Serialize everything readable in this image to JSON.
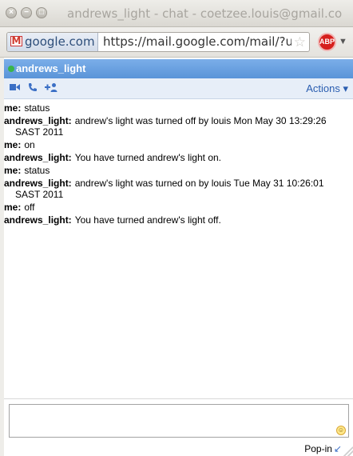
{
  "window": {
    "title": "andrews_light - chat - coetzee.louis@gmail.co",
    "buttons": [
      "×",
      "−",
      "□"
    ]
  },
  "address_bar": {
    "site_label": "google.com",
    "url": "https://mail.google.com/mail/?ui=",
    "star_icon": "star-icon",
    "extension_label": "ABP"
  },
  "chat": {
    "contact_name": "andrews_light",
    "status_color": "#39b54a",
    "toolbar": {
      "icons": [
        "video-icon",
        "phone-icon",
        "add-person-icon"
      ],
      "actions_label": "Actions ▾"
    },
    "messages": [
      {
        "sender": "me:",
        "text": "status"
      },
      {
        "sender": "andrews_light:",
        "text": "andrew's light was turned off by louis Mon May 30 13:29:26 SAST 2011"
      },
      {
        "sender": "me:",
        "text": "on"
      },
      {
        "sender": "andrews_light:",
        "text": "You have turned andrew's light on."
      },
      {
        "sender": "me:",
        "text": "status"
      },
      {
        "sender": "andrews_light:",
        "text": "andrew's light was turned on by louis Tue May 31 10:26:01 SAST 2011"
      },
      {
        "sender": "me:",
        "text": "off"
      },
      {
        "sender": "andrews_light:",
        "text": "You have turned andrew's light off."
      }
    ],
    "compose_value": "",
    "popin_label": "Pop-in"
  },
  "colors": {
    "header_blue": "#5a94d8",
    "accent_blue": "#3b6fc5"
  }
}
